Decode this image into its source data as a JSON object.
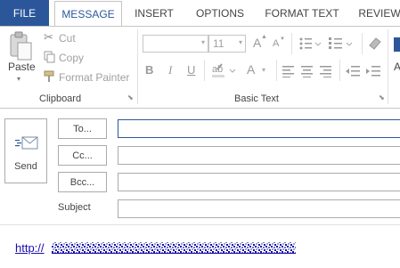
{
  "tabs": [
    "FILE",
    "MESSAGE",
    "INSERT",
    "OPTIONS",
    "FORMAT TEXT",
    "REVIEW"
  ],
  "active_tab": "MESSAGE",
  "clipboard": {
    "paste_label": "Paste",
    "cut_label": "Cut",
    "copy_label": "Copy",
    "format_painter_label": "Format Painter",
    "group_label": "Clipboard"
  },
  "basic_text": {
    "font_size": "11",
    "bold_glyph": "B",
    "italic_glyph": "I",
    "underline_glyph": "U",
    "font_color_glyph": "A",
    "grow_font_glyph": "A",
    "shrink_font_glyph": "A",
    "group_label": "Basic Text",
    "partial_label": "A"
  },
  "compose": {
    "send_label": "Send",
    "to_label": "To...",
    "cc_label": "Cc...",
    "bcc_label": "Bcc...",
    "subject_label": "Subject",
    "body_link_prefix": "http://"
  },
  "colors": {
    "accent": "#2b579a",
    "active_field_border": "#2b579a",
    "link": "#1a0dab"
  }
}
